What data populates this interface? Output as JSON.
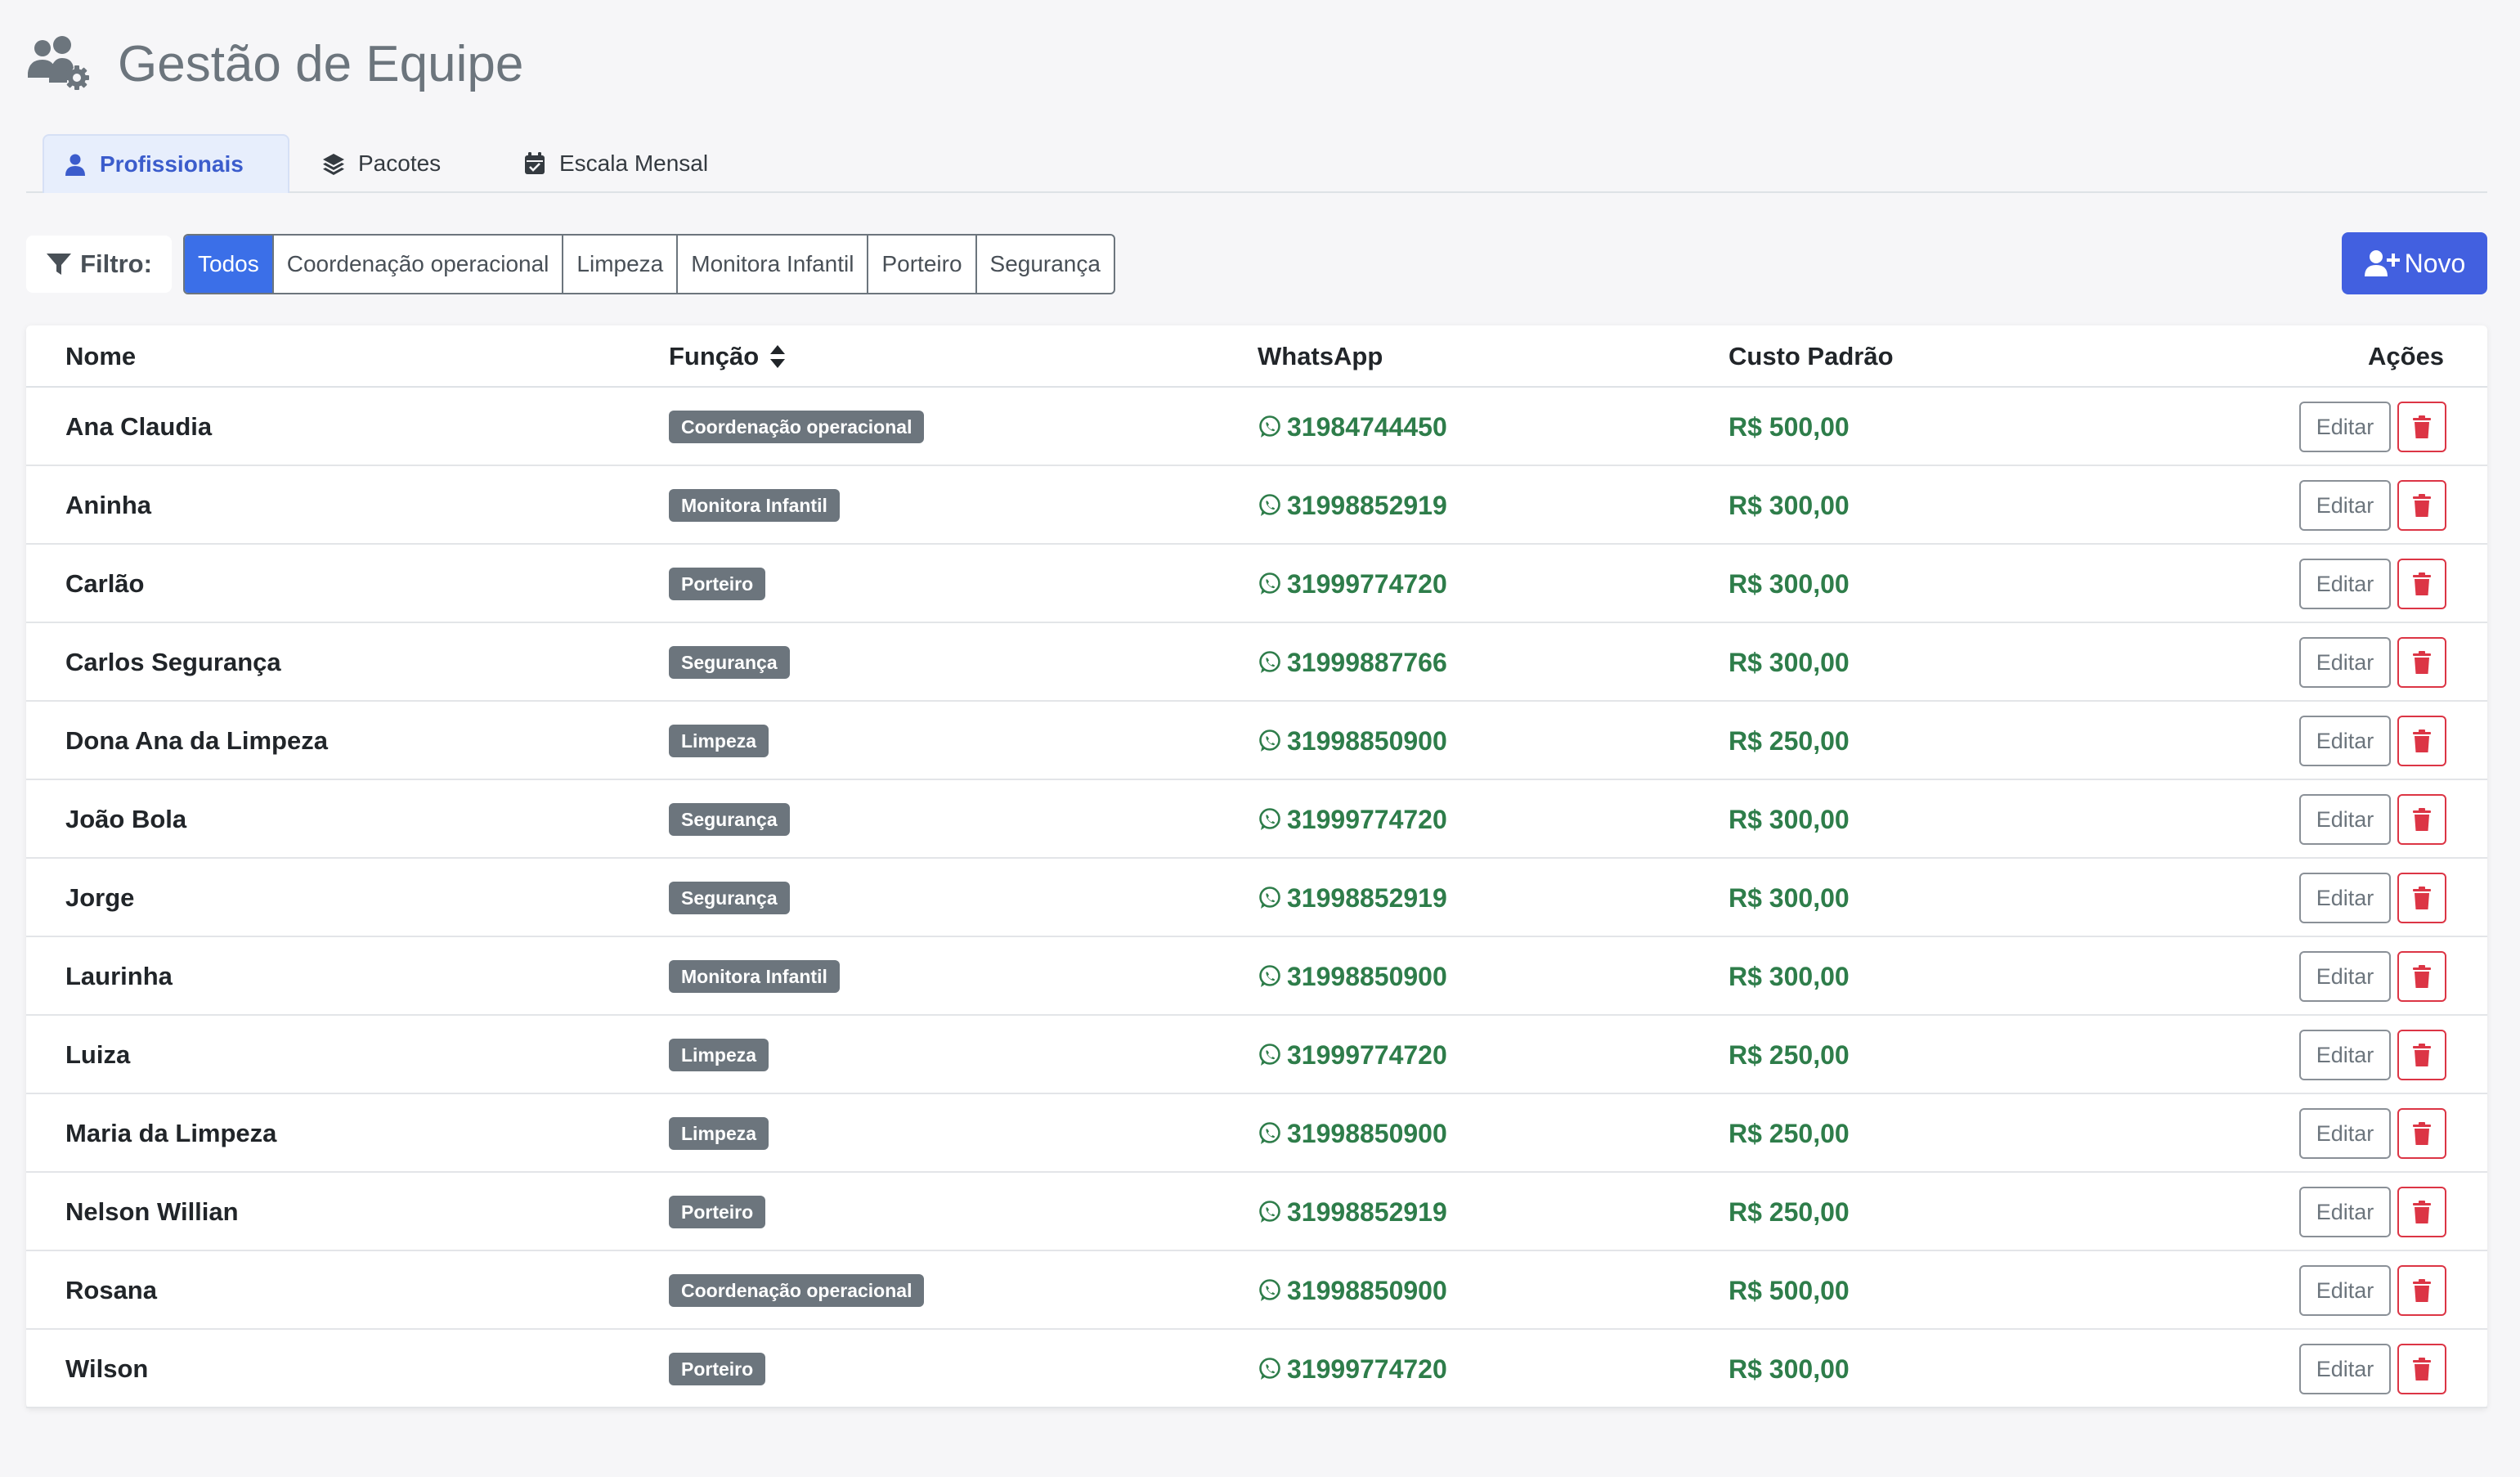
{
  "header": {
    "title": "Gestão de Equipe",
    "icon": "users-gear-icon"
  },
  "tabs": [
    {
      "label": "Profissionais",
      "icon": "user-icon",
      "active": true
    },
    {
      "label": "Pacotes",
      "icon": "layers-icon",
      "active": false
    },
    {
      "label": "Escala Mensal",
      "icon": "calendar-check-icon",
      "active": false
    }
  ],
  "filter": {
    "label": "Filtro:",
    "options": [
      "Todos",
      "Coordenação operacional",
      "Limpeza",
      "Monitora Infantil",
      "Porteiro",
      "Segurança"
    ],
    "selected": "Todos"
  },
  "new_button": {
    "label": "Novo"
  },
  "table": {
    "columns": {
      "name": "Nome",
      "role": "Função",
      "whatsapp": "WhatsApp",
      "cost": "Custo Padrão",
      "actions": "Ações"
    },
    "edit_label": "Editar",
    "rows": [
      {
        "name": "Ana Claudia",
        "role": "Coordenação operacional",
        "whatsapp": "31984744450",
        "cost": "R$ 500,00"
      },
      {
        "name": "Aninha",
        "role": "Monitora Infantil",
        "whatsapp": "31998852919",
        "cost": "R$ 300,00"
      },
      {
        "name": "Carlão",
        "role": "Porteiro",
        "whatsapp": "31999774720",
        "cost": "R$ 300,00"
      },
      {
        "name": "Carlos Segurança",
        "role": "Segurança",
        "whatsapp": "31999887766",
        "cost": "R$ 300,00"
      },
      {
        "name": "Dona Ana da Limpeza",
        "role": "Limpeza",
        "whatsapp": "31998850900",
        "cost": "R$ 250,00"
      },
      {
        "name": "João Bola",
        "role": "Segurança",
        "whatsapp": "31999774720",
        "cost": "R$ 300,00"
      },
      {
        "name": "Jorge",
        "role": "Segurança",
        "whatsapp": "31998852919",
        "cost": "R$ 300,00"
      },
      {
        "name": "Laurinha",
        "role": "Monitora Infantil",
        "whatsapp": "31998850900",
        "cost": "R$ 300,00"
      },
      {
        "name": "Luiza",
        "role": "Limpeza",
        "whatsapp": "31999774720",
        "cost": "R$ 250,00"
      },
      {
        "name": "Maria da Limpeza",
        "role": "Limpeza",
        "whatsapp": "31998850900",
        "cost": "R$ 250,00"
      },
      {
        "name": "Nelson Willian",
        "role": "Porteiro",
        "whatsapp": "31998852919",
        "cost": "R$ 250,00"
      },
      {
        "name": "Rosana",
        "role": "Coordenação operacional",
        "whatsapp": "31998850900",
        "cost": "R$ 500,00"
      },
      {
        "name": "Wilson",
        "role": "Porteiro",
        "whatsapp": "31999774720",
        "cost": "R$ 300,00"
      }
    ]
  },
  "colors": {
    "accent": "#4260e0",
    "active_filter": "#3b6fe8",
    "money_green": "#2e7d4a",
    "danger": "#dc3545",
    "badge": "#6c757d"
  }
}
